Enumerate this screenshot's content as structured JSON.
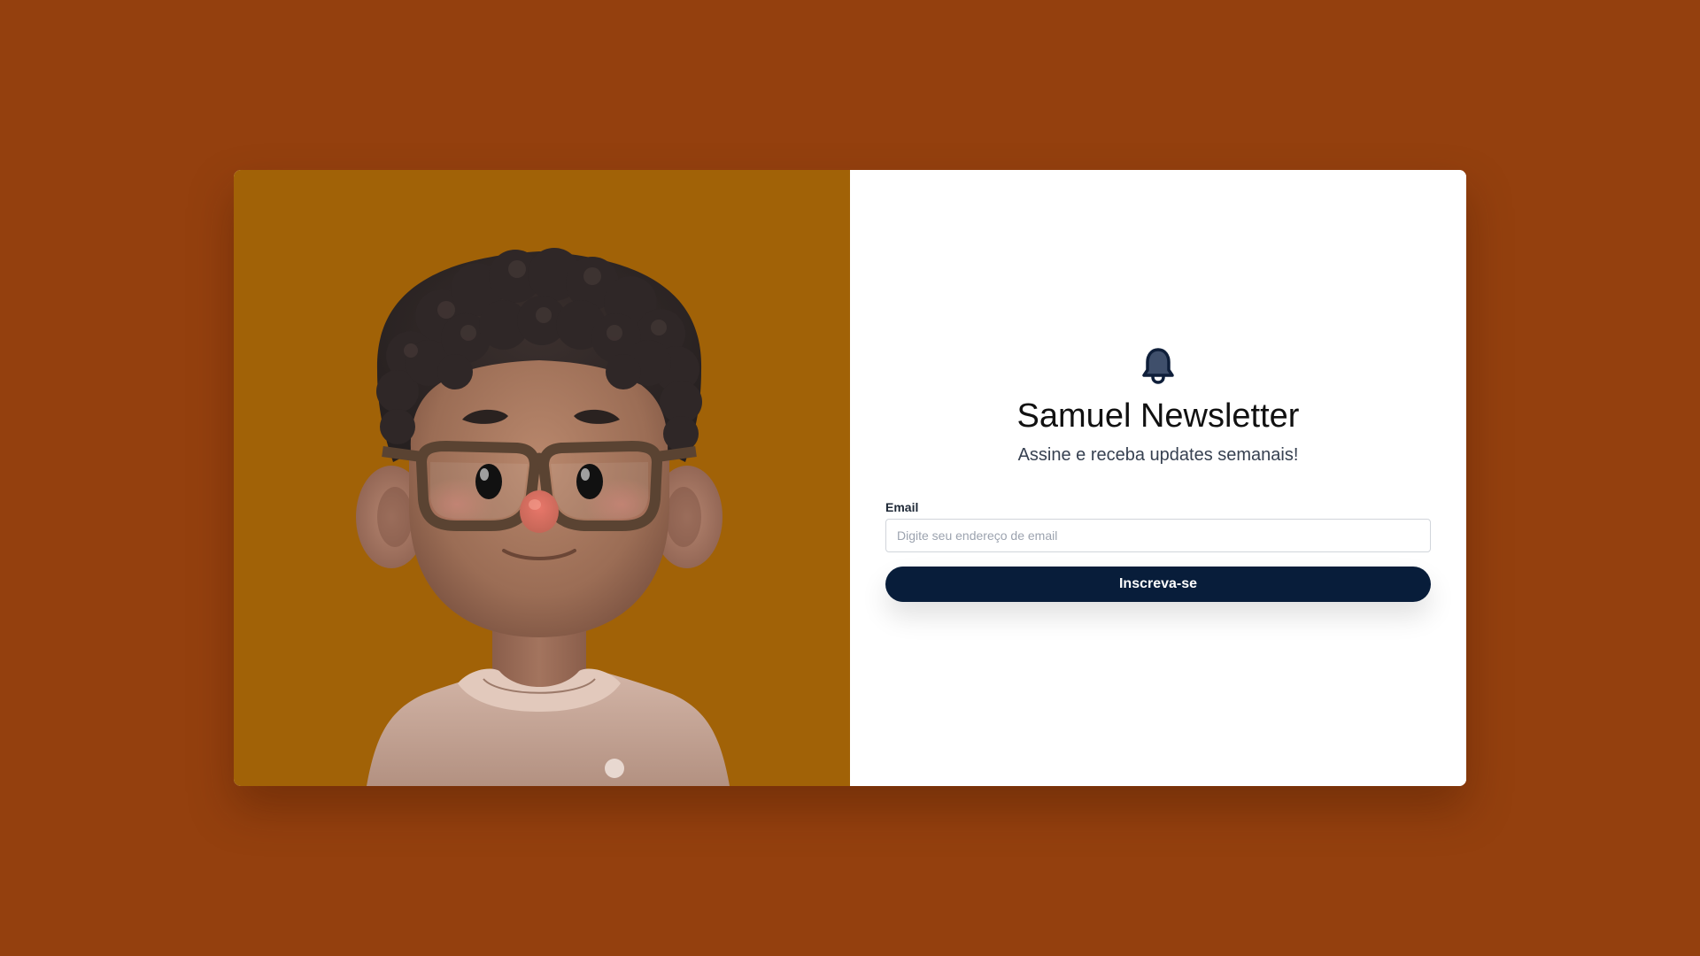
{
  "colors": {
    "page_background": "#94400e",
    "illustration_background": "#a16207",
    "panel_background": "#ffffff",
    "button_background": "#081d3a",
    "button_text": "#ffffff",
    "title_text": "#111111",
    "subtitle_text": "#374151",
    "bell_fill": "#3f4f6b",
    "bell_outline": "#0f1f3a"
  },
  "illustration": {
    "icon": "avatar-3d-illustration"
  },
  "newsletter": {
    "icon": "bell-icon",
    "title": "Samuel Newsletter",
    "subtitle": "Assine e receba updates semanais!",
    "email_label": "Email",
    "email_value": "",
    "email_placeholder": "Digite seu endereço de email",
    "submit_label": "Inscreva-se"
  }
}
